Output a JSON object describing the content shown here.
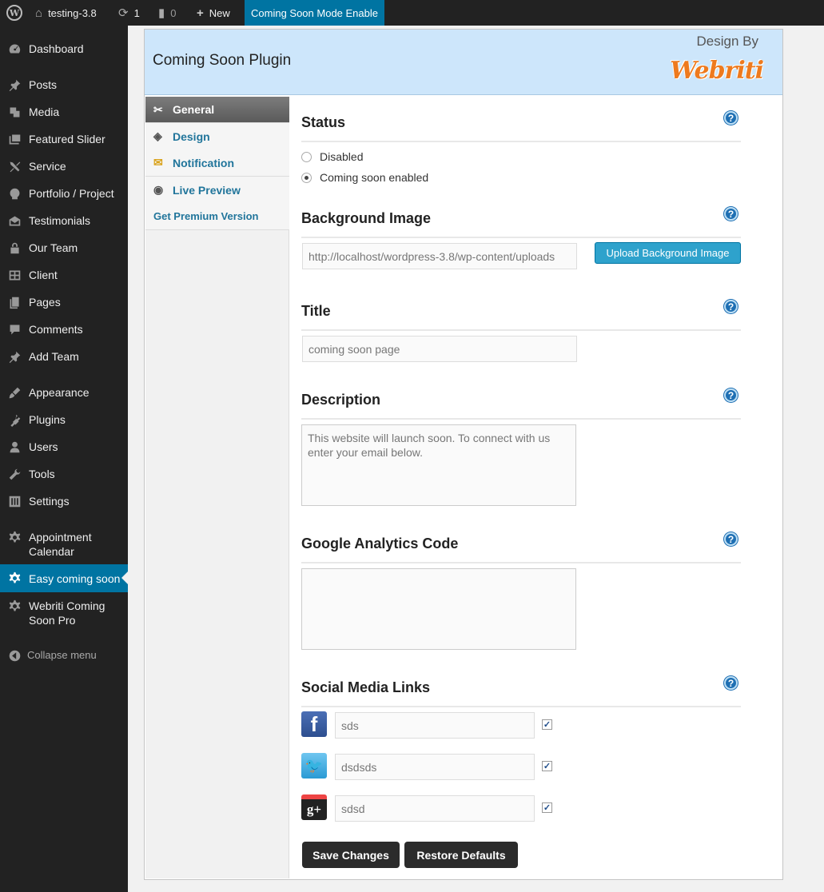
{
  "adminbar": {
    "site_name": "testing-3.8",
    "updates_count": "1",
    "comments_count": "0",
    "new_label": "New",
    "coming_soon_label": "Coming Soon Mode Enable"
  },
  "sidebar": {
    "items": [
      {
        "label": "Dashboard",
        "icon": "dashboard-icon"
      },
      {
        "label": "Posts",
        "icon": "pin-icon"
      },
      {
        "label": "Media",
        "icon": "media-icon"
      },
      {
        "label": "Featured Slider",
        "icon": "slider-icon"
      },
      {
        "label": "Service",
        "icon": "tools-icon"
      },
      {
        "label": "Portfolio / Project",
        "icon": "portfolio-icon"
      },
      {
        "label": "Testimonials",
        "icon": "testimonial-icon"
      },
      {
        "label": "Our Team",
        "icon": "lock-icon"
      },
      {
        "label": "Client",
        "icon": "client-icon"
      },
      {
        "label": "Pages",
        "icon": "pages-icon"
      },
      {
        "label": "Comments",
        "icon": "comment-icon"
      },
      {
        "label": "Add Team",
        "icon": "pin-icon"
      },
      {
        "label": "Appearance",
        "icon": "brush-icon"
      },
      {
        "label": "Plugins",
        "icon": "plugin-icon"
      },
      {
        "label": "Users",
        "icon": "user-icon"
      },
      {
        "label": "Tools",
        "icon": "wrench-icon"
      },
      {
        "label": "Settings",
        "icon": "settings-icon"
      },
      {
        "label": "Appointment Calendar",
        "icon": "gear-icon"
      },
      {
        "label": "Easy coming soon",
        "icon": "gear-icon"
      },
      {
        "label": "Webriti Coming Soon Pro",
        "icon": "gear-icon"
      }
    ],
    "collapse_label": "Collapse menu"
  },
  "panel": {
    "title": "Coming Soon Plugin",
    "design_by": "Design By",
    "logo_text": "Webriti"
  },
  "tabs": [
    {
      "label": "General",
      "icon": "wrench-icon"
    },
    {
      "label": "Design",
      "icon": "paint-bucket-icon"
    },
    {
      "label": "Notification",
      "icon": "envelope-icon"
    },
    {
      "label": "Live Preview",
      "icon": "record-icon"
    },
    {
      "label": "Get Premium Version",
      "icon": ""
    }
  ],
  "status": {
    "title": "Status",
    "options": [
      {
        "label": "Disabled",
        "checked": false
      },
      {
        "label": "Coming soon enabled",
        "checked": true
      }
    ]
  },
  "background": {
    "title": "Background Image",
    "value": "http://localhost/wordpress-3.8/wp-content/uploads",
    "button": "Upload Background Image"
  },
  "title_field": {
    "title": "Title",
    "value": "coming soon page"
  },
  "description": {
    "title": "Description",
    "value": "This website will launch soon. To connect with us enter your email below."
  },
  "analytics": {
    "title": "Google Analytics Code",
    "value": ""
  },
  "social": {
    "title": "Social Media Links",
    "items": [
      {
        "network": "facebook",
        "icon_text": "f",
        "value": "sds",
        "checked": true
      },
      {
        "network": "twitter",
        "icon_text": "🐦",
        "value": "dsdsds",
        "checked": true
      },
      {
        "network": "google-plus",
        "icon_text": "g+",
        "value": "sdsd",
        "checked": true
      }
    ]
  },
  "buttons": {
    "save": "Save Changes",
    "restore": "Restore Defaults"
  },
  "help_symbol": "?"
}
